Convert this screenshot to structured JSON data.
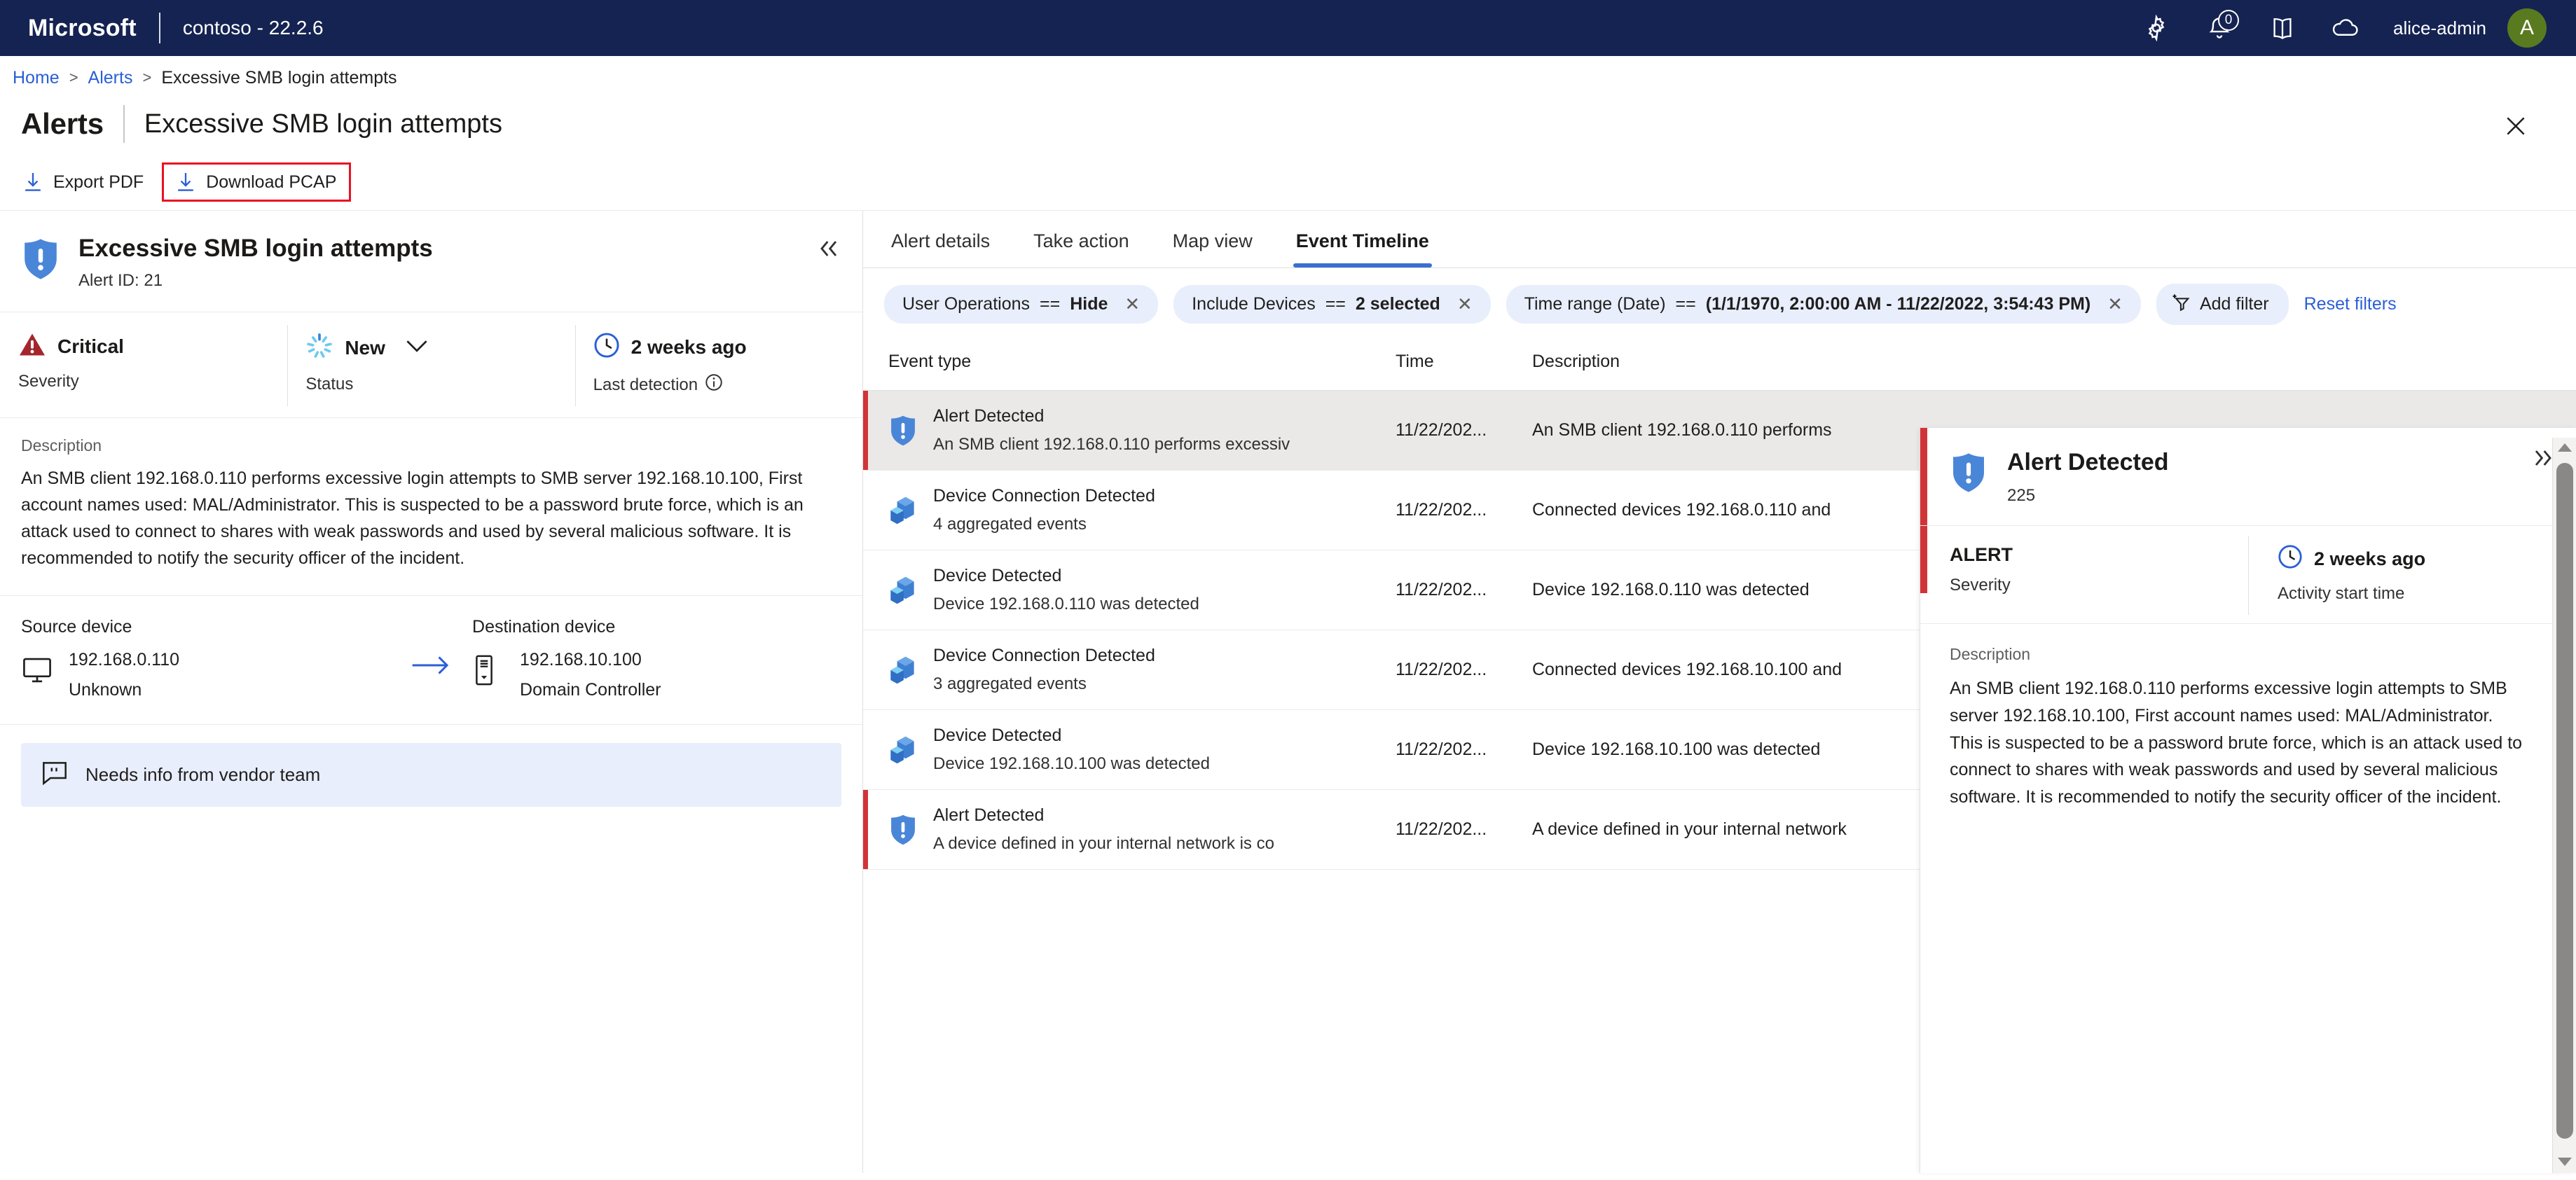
{
  "topbar": {
    "brand": "Microsoft",
    "tenant": "contoso - 22.2.6",
    "notification_count": "0",
    "username": "alice-admin",
    "avatar_initial": "A",
    "accent": "#152352",
    "avatar_color": "#5a7a20"
  },
  "breadcrumb": {
    "home": "Home",
    "sep1": ">",
    "alerts": "Alerts",
    "sep2": ">",
    "current": "Excessive SMB login attempts"
  },
  "header": {
    "title": "Alerts",
    "subtitle": "Excessive SMB login attempts"
  },
  "commandbar": {
    "export_pdf": "Export PDF",
    "download_pcap": "Download PCAP",
    "highlight_color": "#e81123"
  },
  "left_panel": {
    "title": "Excessive SMB login attempts",
    "alert_id": "Alert ID: 21",
    "stats": [
      {
        "value": "Critical",
        "label": "Severity",
        "icon": "severity-critical-icon",
        "color": "#a4262c"
      },
      {
        "value": "New",
        "label": "Status",
        "icon": "status-new-icon",
        "color": "#5ec2ef"
      },
      {
        "value": "2 weeks ago",
        "label": "Last detection",
        "icon": "clock-icon",
        "color": "#2a5fd6"
      }
    ],
    "description_label": "Description",
    "description": "An SMB client 192.168.0.110 performs excessive login attempts to SMB server 192.168.10.100, First account names used: MAL/Administrator. This is suspected to be a password brute force, which is an attack used to connect to shares with weak passwords and used by several malicious software. It is recommended to notify the security officer of the incident.",
    "source_device": {
      "label": "Source device",
      "ip": "192.168.0.110",
      "type": "Unknown",
      "icon": "monitor-icon"
    },
    "destination_device": {
      "label": "Destination device",
      "ip": "192.168.10.100",
      "type": "Domain Controller",
      "icon": "server-icon"
    },
    "note": "Needs info from vendor team"
  },
  "tabs": [
    {
      "label": "Alert details",
      "active": false
    },
    {
      "label": "Take action",
      "active": false
    },
    {
      "label": "Map view",
      "active": false
    },
    {
      "label": "Event Timeline",
      "active": true
    }
  ],
  "filters": {
    "chips": [
      {
        "field": "User Operations",
        "operator": "==",
        "value": "Hide"
      },
      {
        "field": "Include Devices",
        "operator": "==",
        "value": "2 selected"
      },
      {
        "field": "Time range (Date)",
        "operator": "==",
        "value": "(1/1/1970, 2:00:00 AM - 11/22/2022, 3:54:43 PM)"
      }
    ],
    "add_filter": "Add filter",
    "reset_filters": "Reset filters"
  },
  "table": {
    "columns": [
      "Event type",
      "Time",
      "Description"
    ],
    "rows": [
      {
        "type": "Alert Detected",
        "subtitle": "An SMB client 192.168.0.110 performs excessiv",
        "time": "11/22/202...",
        "description": "An SMB client 192.168.0.110 performs",
        "icon": "alert-shield-icon",
        "selected": true,
        "alert": true
      },
      {
        "type": "Device Connection Detected",
        "subtitle": "4 aggregated events",
        "time": "11/22/202...",
        "description": "Connected devices 192.168.0.110 and",
        "icon": "device-cube-icon",
        "selected": false,
        "alert": false
      },
      {
        "type": "Device Detected",
        "subtitle": "Device 192.168.0.110 was detected",
        "time": "11/22/202...",
        "description": "Device 192.168.0.110 was detected",
        "icon": "device-cube-icon",
        "selected": false,
        "alert": false
      },
      {
        "type": "Device Connection Detected",
        "subtitle": "3 aggregated events",
        "time": "11/22/202...",
        "description": "Connected devices 192.168.10.100 and",
        "icon": "device-cube-icon",
        "selected": false,
        "alert": false
      },
      {
        "type": "Device Detected",
        "subtitle": "Device 192.168.10.100 was detected",
        "time": "11/22/202...",
        "description": "Device 192.168.10.100 was detected",
        "icon": "device-cube-icon",
        "selected": false,
        "alert": false
      },
      {
        "type": "Alert Detected",
        "subtitle": "A device defined in your internal network is co",
        "time": "11/22/202...",
        "description": "A device defined in your internal network",
        "icon": "alert-shield-icon",
        "selected": false,
        "alert": true
      }
    ]
  },
  "right_panel": {
    "title": "Alert Detected",
    "subtitle": "225",
    "accent": "#d13438",
    "stats": [
      {
        "value": "ALERT",
        "label": "Severity"
      },
      {
        "value": "2 weeks ago",
        "label": "Activity start time",
        "icon": "clock-icon"
      }
    ],
    "description_label": "Description",
    "description": "An SMB client 192.168.0.110 performs excessive login attempts to SMB server 192.168.10.100, First account names used: MAL/Administrator. This is suspected to be a password brute force, which is an attack used to connect to shares with weak passwords and used by several malicious software. It is recommended to notify the security officer of the incident."
  }
}
